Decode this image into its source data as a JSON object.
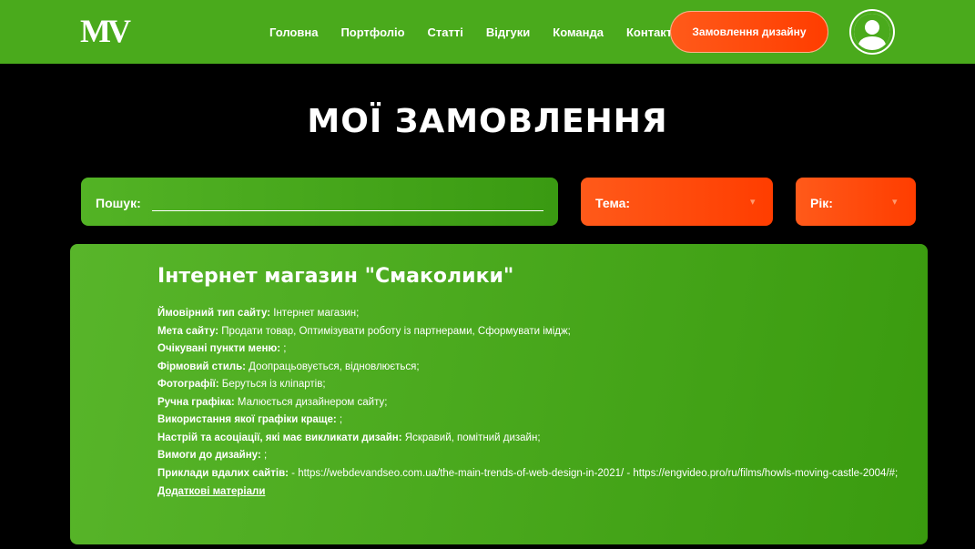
{
  "header": {
    "logo": "MV",
    "nav": [
      "Головна",
      "Портфоліо",
      "Статті",
      "Відгуки",
      "Команда",
      "Контакти"
    ],
    "order_button": "Замовлення дизайну",
    "avatar_icon": "user-avatar-icon",
    "accent_color": "#4aaa1c",
    "button_color": "#ff4a10"
  },
  "page": {
    "title": "МОЇ ЗАМОВЛЕННЯ"
  },
  "filters": {
    "search_label": "Пошук:",
    "search_value": "",
    "theme_label": "Тема:",
    "year_label": "Рік:"
  },
  "order": {
    "title": "Інтернет магазин \"Смаколики\"",
    "fields": [
      {
        "label": "Ймовірний тип сайту:",
        "value": " Інтернет магазин;"
      },
      {
        "label": "Мета сайту:",
        "value": " Продати товар, Оптимізувати роботу із партнерами, Сформувати імідж;"
      },
      {
        "label": "Очікувані пункти меню:",
        "value": " ;"
      },
      {
        "label": "Фірмовий стиль:",
        "value": " Доопрацьовується, відновлюється;"
      },
      {
        "label": "Фотографії:",
        "value": " Беруться із кліпартів;"
      },
      {
        "label": "Ручна графіка:",
        "value": " Малюється дизайнером сайту;"
      },
      {
        "label": "Використання якої графіки краще:",
        "value": " ;"
      },
      {
        "label": "Настрій та асоціації, які має викликати дизайн:",
        "value": " Яскравий, помітний дизайн;"
      },
      {
        "label": "Вимоги до дизайну:",
        "value": " ;"
      },
      {
        "label": "Приклади вдалих сайтів:",
        "value": " - https://webdevandseo.com.ua/the-main-trends-of-web-design-in-2021/ - https://engvideo.pro/ru/films/howls-moving-castle-2004/#;"
      }
    ],
    "more_link": "Додаткові матеріали"
  }
}
